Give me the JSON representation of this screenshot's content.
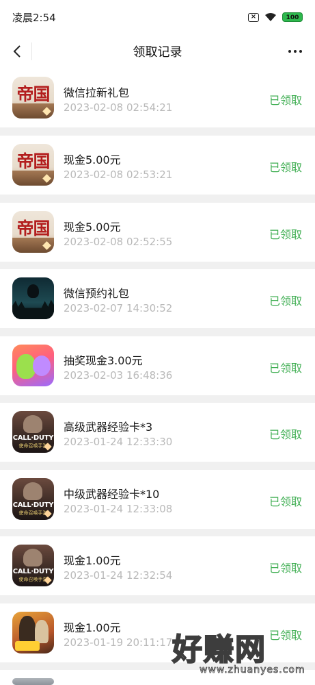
{
  "status_bar": {
    "time": "凌晨2:54",
    "battery": "100"
  },
  "nav": {
    "title": "领取记录"
  },
  "records": [
    {
      "icon": "empire-game-icon",
      "title": "微信拉新礼包",
      "time": "2023-02-08 02:54:21",
      "status": "已领取"
    },
    {
      "icon": "empire-game-icon",
      "title": "现金5.00元",
      "time": "2023-02-08 02:53:21",
      "status": "已领取"
    },
    {
      "icon": "empire-game-icon",
      "title": "现金5.00元",
      "time": "2023-02-08 02:52:55",
      "status": "已领取"
    },
    {
      "icon": "forest-game-icon",
      "title": "微信预约礼包",
      "time": "2023-02-07 14:30:52",
      "status": "已领取"
    },
    {
      "icon": "cute-game-icon",
      "title": "抽奖现金3.00元",
      "time": "2023-02-03 16:48:36",
      "status": "已领取"
    },
    {
      "icon": "call-of-duty-icon",
      "title": "高级武器经验卡*3",
      "time": "2023-01-24 12:33:30",
      "status": "已领取"
    },
    {
      "icon": "call-of-duty-icon",
      "title": "中级武器经验卡*10",
      "time": "2023-01-24 12:33:08",
      "status": "已领取"
    },
    {
      "icon": "call-of-duty-icon",
      "title": "现金1.00元",
      "time": "2023-01-24 12:32:54",
      "status": "已领取"
    },
    {
      "icon": "pubg-game-icon",
      "title": "现金1.00元",
      "time": "2023-01-19 20:11:17",
      "status": "已领取"
    }
  ],
  "icon_text": {
    "empire": "帝国",
    "cod_logo": "CALL·DUTY",
    "cod_sub": "使命召唤手游"
  },
  "watermark": {
    "text": "好赚网",
    "domain": "www.zhuanyes.com"
  },
  "colors": {
    "status_green": "#3fae52",
    "time_gray": "#b9b9b9",
    "background": "#f0f0f0"
  }
}
